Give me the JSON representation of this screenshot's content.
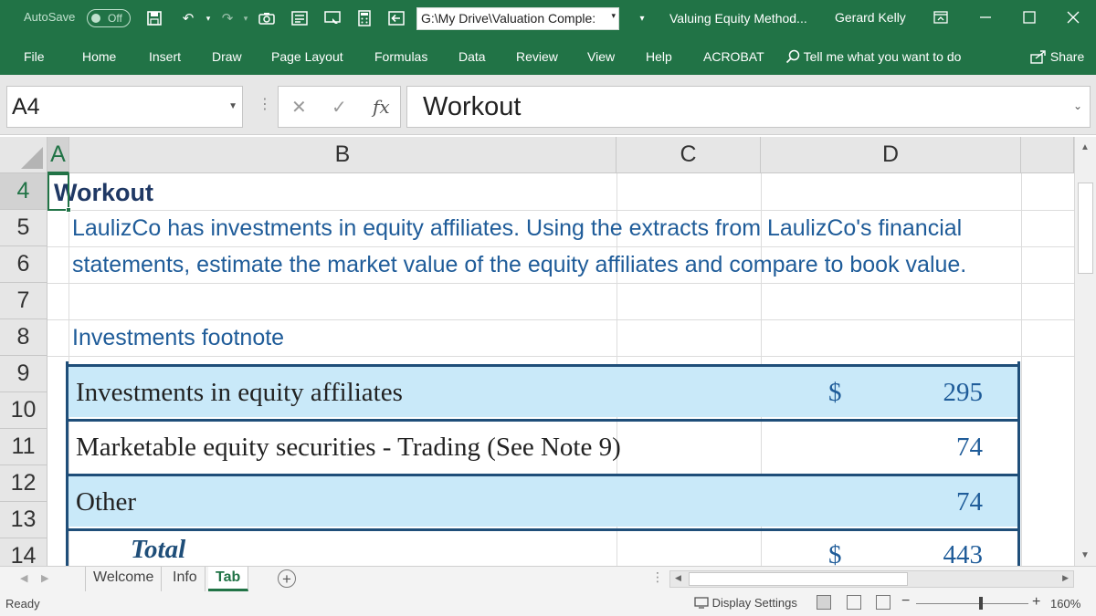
{
  "titlebar": {
    "autosave_label": "AutoSave",
    "autosave_state": "Off",
    "file_path": "G:\\My Drive\\Valuation Comple:",
    "document_title": "Valuing Equity Method...",
    "user_name": "Gerard Kelly",
    "icons": [
      "save-icon",
      "undo-icon",
      "redo-icon",
      "camera-icon",
      "form-icon",
      "screen-icon",
      "calculator-icon",
      "back-icon"
    ]
  },
  "ribbon": {
    "tabs": [
      "File",
      "Home",
      "Insert",
      "Draw",
      "Page Layout",
      "Formulas",
      "Data",
      "Review",
      "View",
      "Help",
      "ACROBAT"
    ],
    "tell_me": "Tell me what you want to do",
    "share": "Share"
  },
  "formula_bar": {
    "name_box": "A4",
    "formula": "Workout"
  },
  "grid": {
    "columns": [
      "A",
      "B",
      "C",
      "D"
    ],
    "rows": [
      "4",
      "5",
      "6",
      "7",
      "8",
      "9",
      "10",
      "11",
      "12",
      "13",
      "14"
    ],
    "selected_cell": "A4",
    "cells": {
      "a4": "Workout",
      "b5": "LaulizCo has investments in equity affiliates. Using the extracts from LaulizCo's financial",
      "b6": "statements, estimate the market value of the equity affiliates and compare to book value.",
      "b8": "Investments footnote"
    },
    "footnote": {
      "rows": [
        {
          "label": "Investments in equity affiliates",
          "dollar": "$",
          "value": "295"
        },
        {
          "label": "Marketable equity securities - Trading (See Note 9)",
          "dollar": "",
          "value": "74"
        },
        {
          "label": "Other",
          "dollar": "",
          "value": "74"
        }
      ],
      "total_label": "Total",
      "total_dollar": "$",
      "total_value": "443"
    }
  },
  "sheets": {
    "tabs": [
      "Welcome",
      "Info",
      "Tab"
    ],
    "active": "Tab"
  },
  "status": {
    "ready": "Ready",
    "display_settings": "Display Settings",
    "zoom": "160%"
  },
  "colors": {
    "excel_green": "#217346",
    "text_blue": "#1f5c99",
    "heading_navy": "#1f3864",
    "footnote_shade": "#c9e9f9",
    "footnote_border": "#1f4e79"
  }
}
